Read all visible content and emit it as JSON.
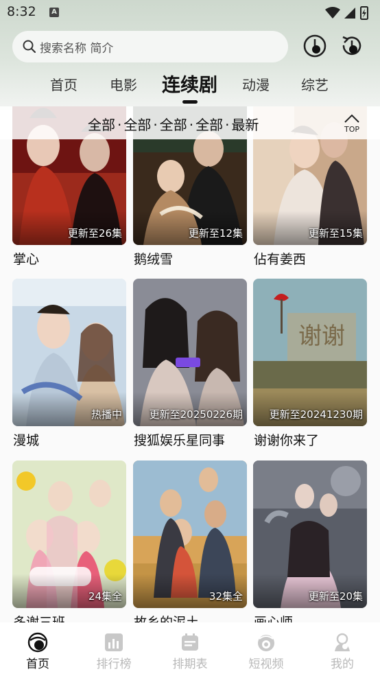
{
  "status_bar": {
    "time": "8:32",
    "notification_icon": "A"
  },
  "search": {
    "placeholder": "搜索名称 简介"
  },
  "tabs": [
    {
      "label": "首页",
      "active": false
    },
    {
      "label": "电影",
      "active": false
    },
    {
      "label": "连续剧",
      "active": true
    },
    {
      "label": "动漫",
      "active": false
    },
    {
      "label": "综艺",
      "active": false
    }
  ],
  "filters": [
    "全部",
    "全部",
    "全部",
    "全部",
    "最新"
  ],
  "filter_separator": "·",
  "top_button": {
    "label": "TOP"
  },
  "cards": [
    {
      "title": "掌心",
      "badge": "更新至26集"
    },
    {
      "title": "鹅绒雪",
      "badge": "更新至12集"
    },
    {
      "title": "佔有姜西",
      "badge": "更新至15集"
    },
    {
      "title": "漫城",
      "badge": "热播中"
    },
    {
      "title": "搜狐娱乐星同事",
      "badge": "更新至20250226期"
    },
    {
      "title": "谢谢你来了",
      "badge": "更新至20241230期"
    },
    {
      "title": "多谢三班",
      "badge": "24集全"
    },
    {
      "title": "故乡的泥土",
      "badge": "32集全"
    },
    {
      "title": "画心师",
      "badge": "更新至20集"
    }
  ],
  "bottom_nav": [
    {
      "label": "首页",
      "icon": "home-icon",
      "active": true
    },
    {
      "label": "排行榜",
      "icon": "ranking-icon",
      "active": false
    },
    {
      "label": "排期表",
      "icon": "calendar-icon",
      "active": false
    },
    {
      "label": "短视频",
      "icon": "short-video-icon",
      "active": false
    },
    {
      "label": "我的",
      "icon": "profile-icon",
      "active": false
    }
  ],
  "colors": {
    "header_gradient_top": "#cdd8cd",
    "active_text": "#111111",
    "inactive_nav": "#b8b8b8",
    "background": "#fafafa"
  }
}
